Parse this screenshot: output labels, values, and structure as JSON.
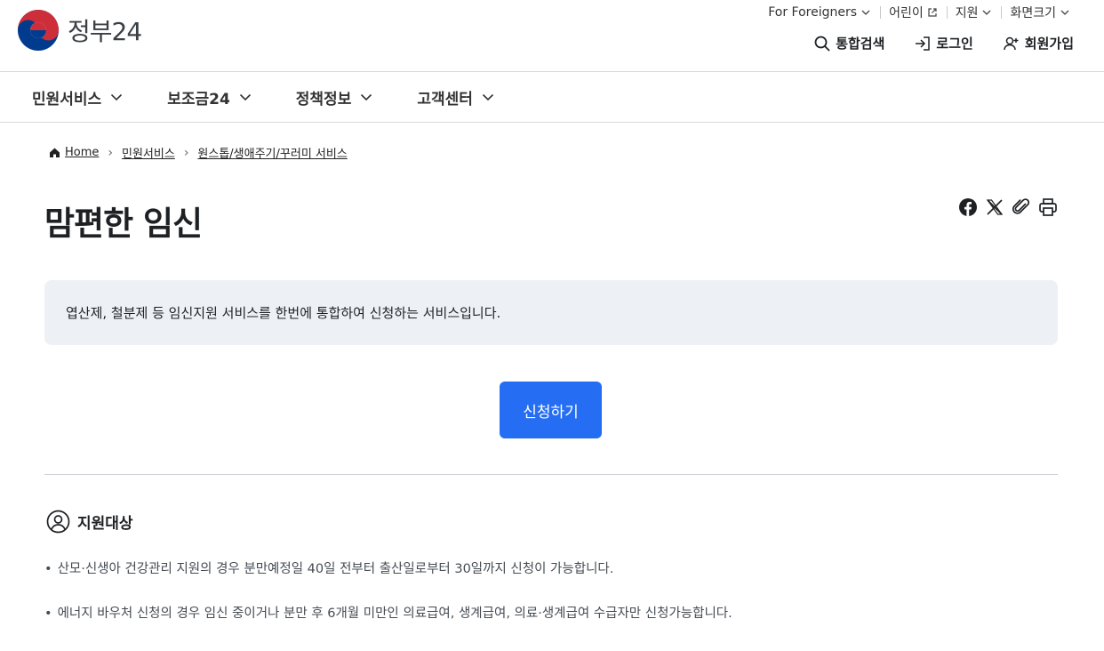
{
  "header": {
    "logo_text": "정부24",
    "utility": [
      {
        "label": "For Foreigners",
        "icon": "chevron-down-icon"
      },
      {
        "label": "어린이",
        "icon": "external-link-icon"
      },
      {
        "label": "지원",
        "icon": "chevron-down-icon"
      },
      {
        "label": "화면크기",
        "icon": "chevron-down-icon"
      }
    ],
    "actions": {
      "search": "통합검색",
      "login": "로그인",
      "signup": "회원가입"
    }
  },
  "nav": {
    "items": [
      "민원서비스",
      "보조금24",
      "정책정보",
      "고객센터"
    ]
  },
  "breadcrumb": [
    "Home",
    "민원서비스",
    "원스톱/생애주기/꾸러미 서비스"
  ],
  "page": {
    "title": "맘편한 임신",
    "description": "엽산제, 철분제 등 임신지원 서비스를 한번에 통합하여 신청하는 서비스입니다.",
    "apply_label": "신청하기"
  },
  "section": {
    "title": "지원대상",
    "bullets": [
      "산모·신생아 건강관리 지원의 경우 분만예정일 40일 전부터 출산일로부터 30일까지 신청이 가능합니다.",
      "에너지 바우처 신청의 경우 임신 중이거나 분만 후 6개월 미만인 의료급여, 생계급여, 의료·생계급여 수급자만 신청가능합니다."
    ]
  },
  "colors": {
    "primary": "#256ef4",
    "info_bg": "#edf1f5",
    "text": "#1e2124"
  }
}
